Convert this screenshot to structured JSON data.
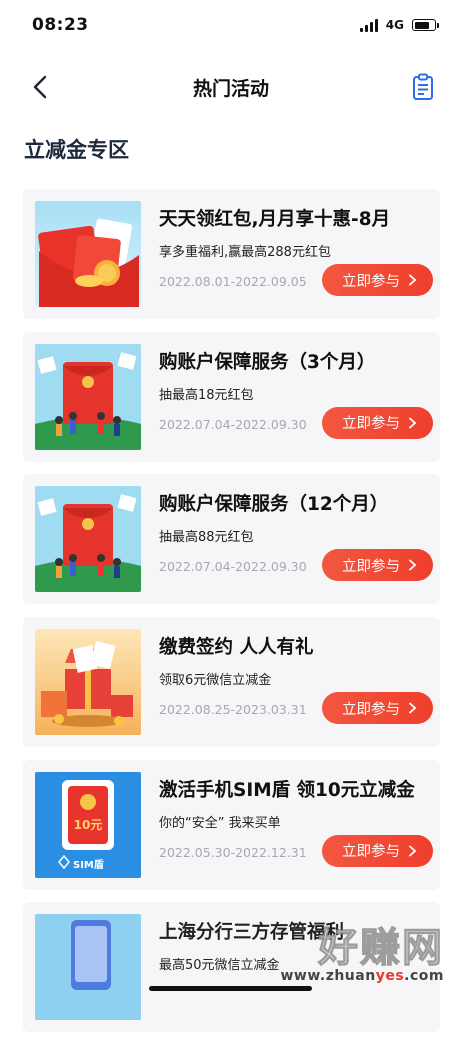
{
  "status_bar": {
    "time": "08:23",
    "network": "4G",
    "battery_level": 0.75
  },
  "nav": {
    "title": "热门活动",
    "icons": {
      "back": "back-arrow-icon",
      "right": "clipboard-list-icon"
    }
  },
  "section_title": "立减金专区",
  "button_label": "立即参与",
  "cards": [
    {
      "title": "天天领红包,月月享十惠-8月",
      "desc": "享多重福利,赢最高288元红包",
      "date": "2022.08.01-2022.09.05",
      "thumb": "red-envelope-image"
    },
    {
      "title": "购账户保障服务（3个月）",
      "desc": "抽最高18元红包",
      "date": "2022.07.04-2022.09.30",
      "thumb": "red-envelope-people-image"
    },
    {
      "title": "购账户保障服务（12个月）",
      "desc": "抽最高88元红包",
      "date": "2022.07.04-2022.09.30",
      "thumb": "red-envelope-people-image"
    },
    {
      "title": "缴费签约 人人有礼",
      "desc": "领取6元微信立减金",
      "date": "2022.08.25-2023.03.31",
      "thumb": "gift-box-image"
    },
    {
      "title": "激活手机SIM盾 领10元立减金",
      "desc": "你的“安全” 我来买单",
      "date": "2022.05.30-2022.12.31",
      "thumb": "sim-shield-envelope-image",
      "thumb_text": {
        "amount": "10元",
        "badge": "SIM盾"
      }
    },
    {
      "title": "上海分行三方存管福利",
      "desc": "最高50元微信立减金",
      "date": "",
      "thumb": "phone-image"
    }
  ],
  "watermark": {
    "logo": "好赚网",
    "url_prefix": "www.zhuan",
    "url_highlight": "yes",
    "url_suffix": ".com"
  }
}
